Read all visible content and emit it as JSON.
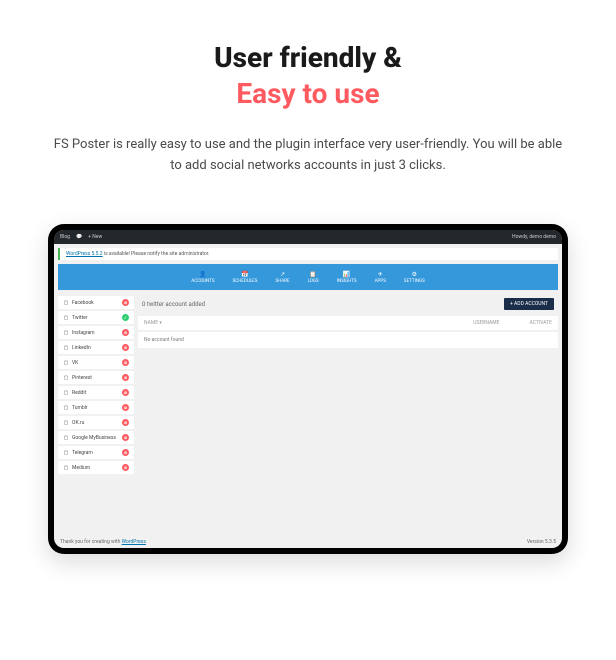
{
  "hero": {
    "title_line1": "User friendly &",
    "title_line2": "Easy to use",
    "description": "FS Poster is really easy to use and the plugin interface very user-friendly. You will be able to add social networks accounts in just 3 clicks."
  },
  "wp_topbar": {
    "blog": "Blog",
    "new": "+ New",
    "howdy": "Howdy, demo demo"
  },
  "wp_notice": {
    "link": "WordPress 5.5.2",
    "text": " is available! Please notify the site administrator."
  },
  "nav": [
    {
      "label": "ACCOUNTS",
      "icon": "👤"
    },
    {
      "label": "SCHEDULES",
      "icon": "📅"
    },
    {
      "label": "SHARE",
      "icon": "↗"
    },
    {
      "label": "LOGS",
      "icon": "📋"
    },
    {
      "label": "INSIGHTS",
      "icon": "📊"
    },
    {
      "label": "APPS",
      "icon": "✈"
    },
    {
      "label": "SETTINGS",
      "icon": "⚙"
    }
  ],
  "sidebar": [
    {
      "name": "Facebook",
      "badge": "red"
    },
    {
      "name": "Twitter",
      "badge": "green"
    },
    {
      "name": "Instagram",
      "badge": "red"
    },
    {
      "name": "LinkedIn",
      "badge": "red"
    },
    {
      "name": "VK",
      "badge": "red"
    },
    {
      "name": "Pinterest",
      "badge": "red"
    },
    {
      "name": "Reddit",
      "badge": "red"
    },
    {
      "name": "Tumblr",
      "badge": "red"
    },
    {
      "name": "OK.ru",
      "badge": "red"
    },
    {
      "name": "Google MyBusiness",
      "badge": "red"
    },
    {
      "name": "Telegram",
      "badge": "red"
    },
    {
      "name": "Medium",
      "badge": "red"
    }
  ],
  "content": {
    "heading": "0 twitter account added",
    "add_button": "+ ADD ACCOUNT",
    "col_name": "NAME ▾",
    "col_username": "USERNAME",
    "col_activate": "ACTIVATE",
    "empty": "No account found"
  },
  "footer": {
    "left_prefix": "Thank you for creating with ",
    "left_link": "WordPress",
    "right": "Version 5.3.5"
  }
}
